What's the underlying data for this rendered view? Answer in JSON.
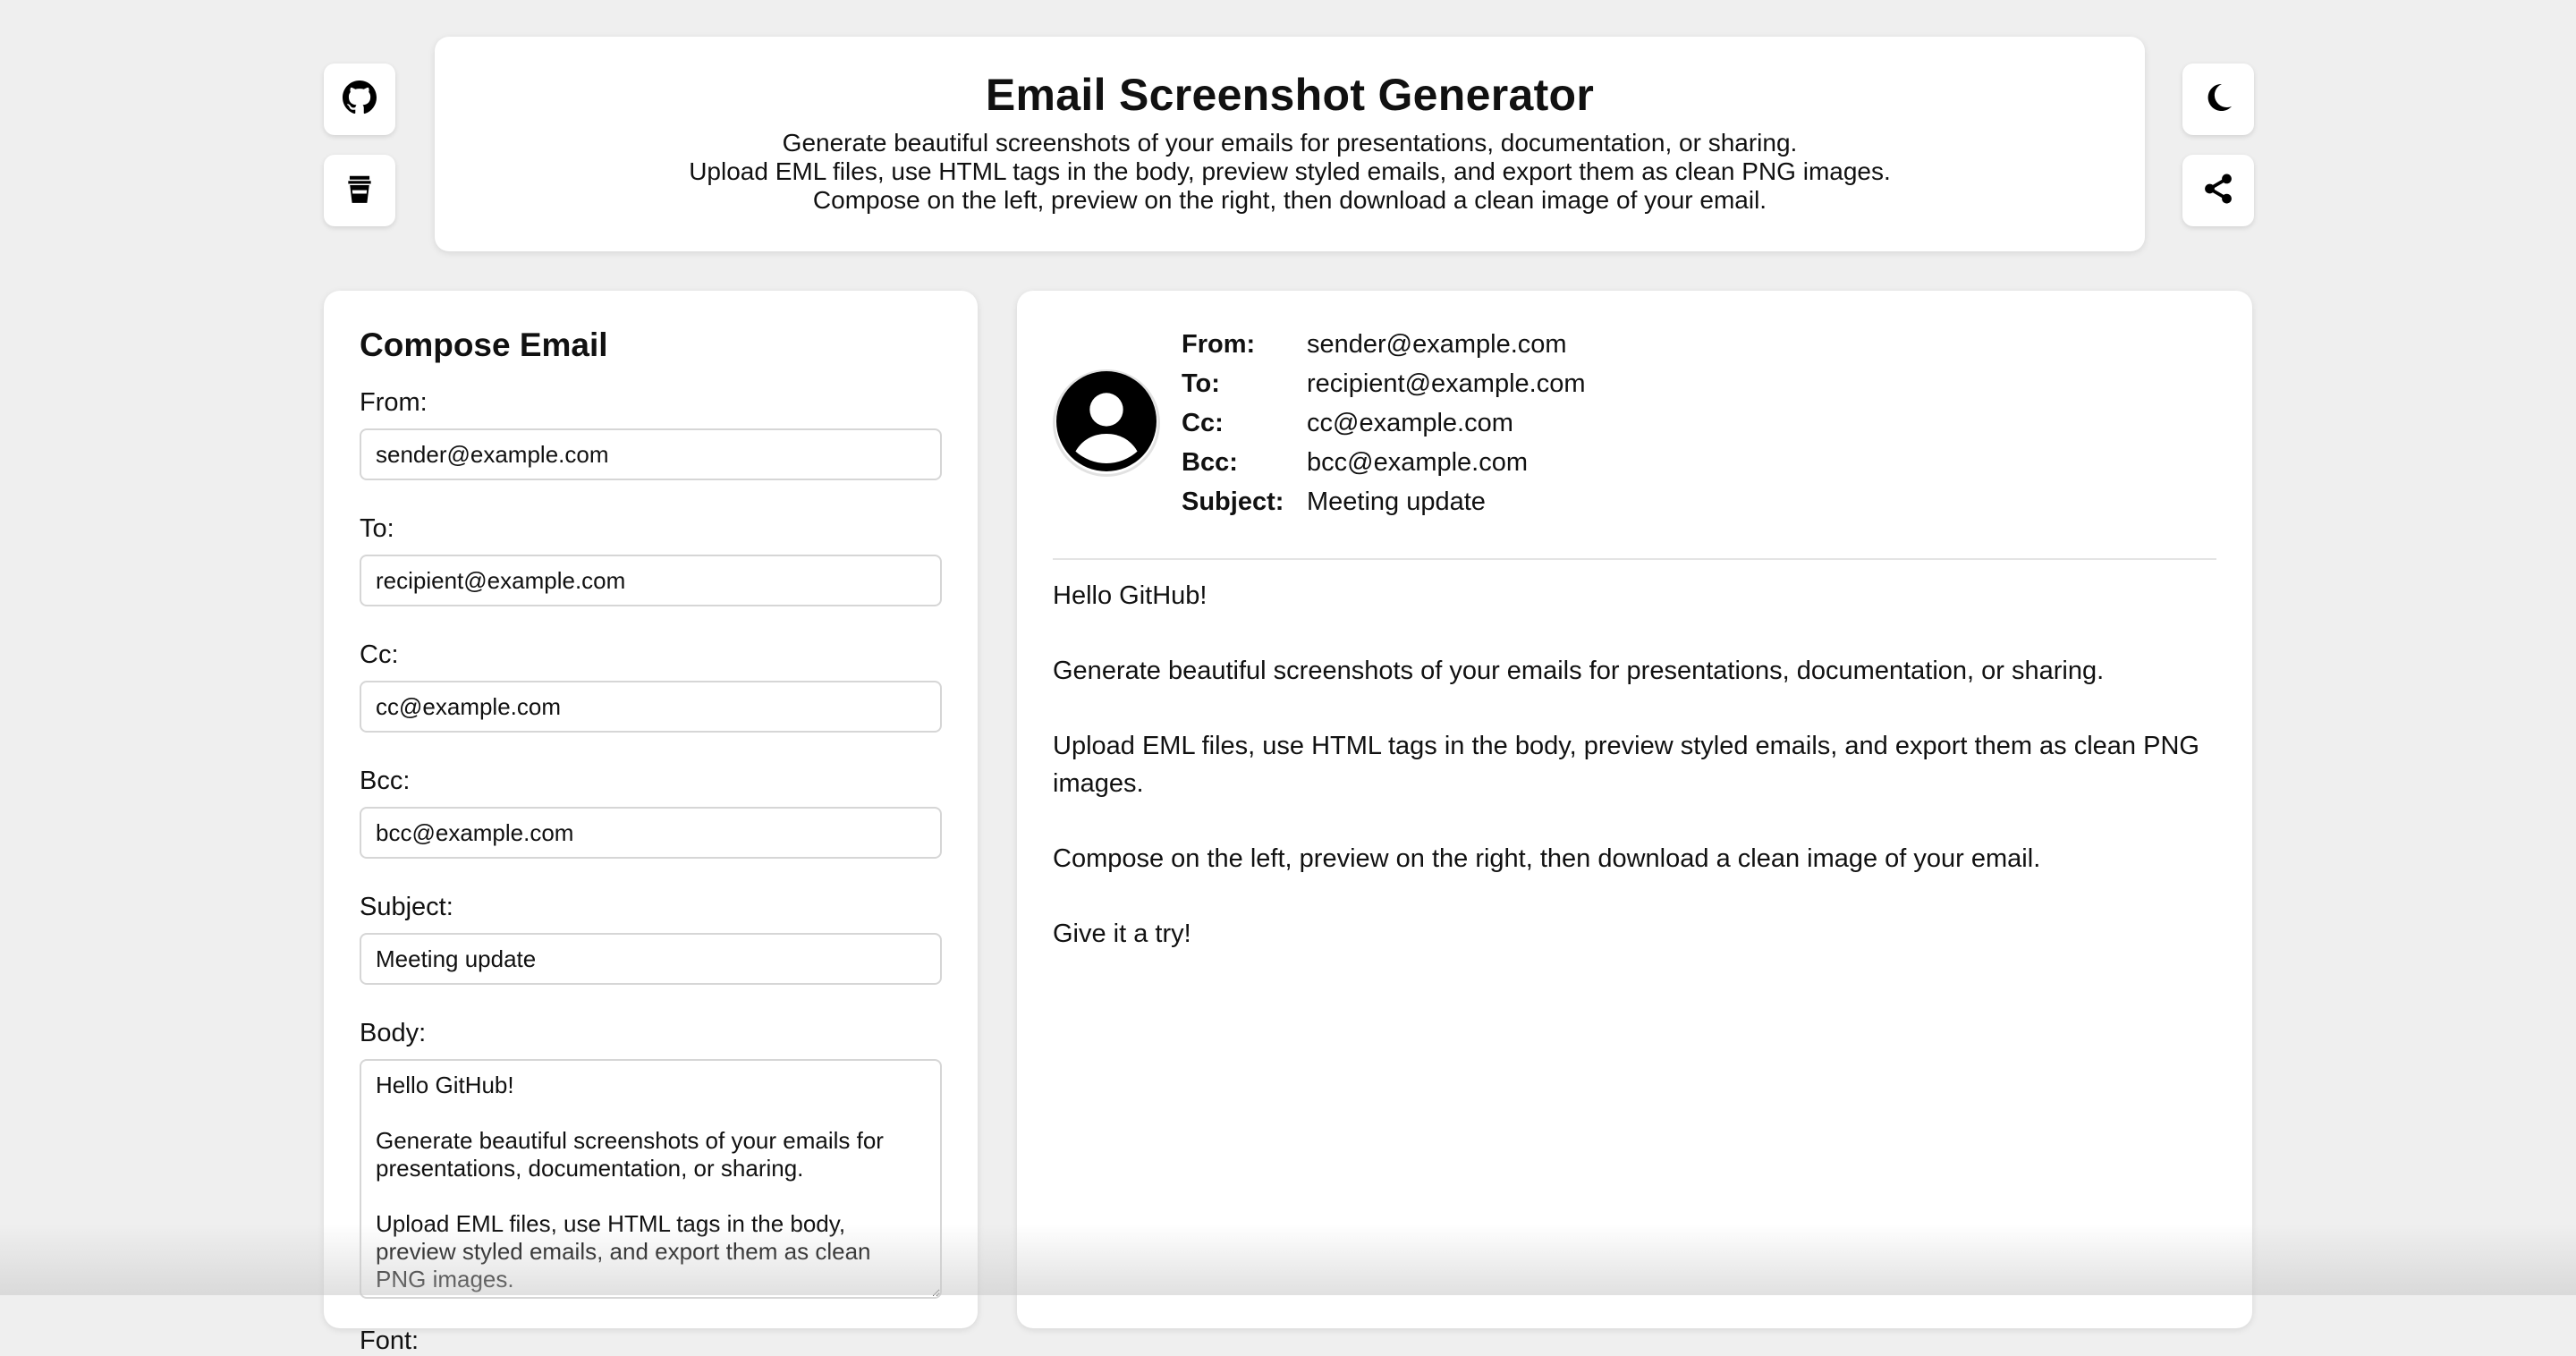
{
  "header": {
    "title": "Email Screenshot Generator",
    "lines": [
      "Generate beautiful screenshots of your emails for presentations, documentation, or sharing.",
      "Upload EML files, use HTML tags in the body, preview styled emails, and export them as clean PNG images.",
      "Compose on the left, preview on the right, then download a clean image of your email."
    ]
  },
  "icons": {
    "left_top": "github-icon",
    "left_bottom": "coffee-cup-icon",
    "right_top": "moon-icon",
    "right_bottom": "share-icon"
  },
  "compose": {
    "title": "Compose Email",
    "from_label": "From:",
    "from_value": "sender@example.com",
    "to_label": "To:",
    "to_value": "recipient@example.com",
    "cc_label": "Cc:",
    "cc_value": "cc@example.com",
    "bcc_label": "Bcc:",
    "bcc_value": "bcc@example.com",
    "subject_label": "Subject:",
    "subject_value": "Meeting update",
    "body_label": "Body:",
    "body_value": "Hello GitHub!\n\nGenerate beautiful screenshots of your emails for presentations, documentation, or sharing.\n\nUpload EML files, use HTML tags in the body, preview styled emails, and export them as clean PNG images.",
    "font_label": "Font:"
  },
  "preview": {
    "from_key": "From:",
    "from_val": "sender@example.com",
    "to_key": "To:",
    "to_val": "recipient@example.com",
    "cc_key": "Cc:",
    "cc_val": "cc@example.com",
    "bcc_key": "Bcc:",
    "bcc_val": "bcc@example.com",
    "subject_key": "Subject:",
    "subject_val": "Meeting update",
    "paragraphs": [
      "Hello GitHub!",
      "Generate beautiful screenshots of your emails for presentations, documentation, or sharing.",
      "Upload EML files, use HTML tags in the body, preview styled emails, and export them as clean PNG images.",
      "Compose on the left, preview on the right, then download a clean image of your email.",
      "Give it a try!"
    ]
  }
}
